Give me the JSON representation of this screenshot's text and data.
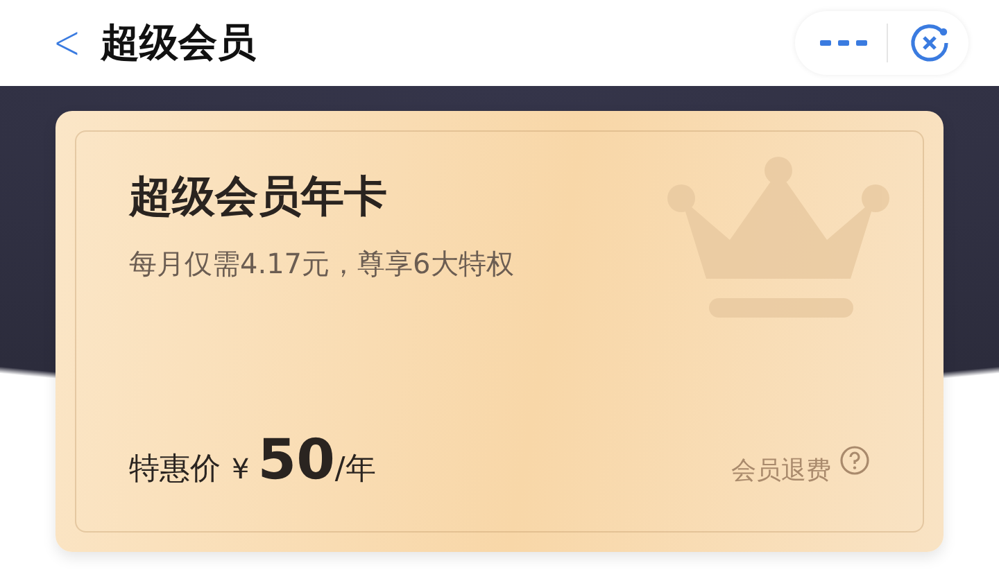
{
  "nav_bar": {
    "back": "<",
    "title": "超级会员"
  },
  "card": {
    "title": "超级会员年卡",
    "subtitle": "每月仅需4.17元，尊享6大特权",
    "price": {
      "label": "特惠价",
      "currency": "¥",
      "amount": "50",
      "unit": "/年"
    },
    "refund_link": "会员退费"
  }
}
